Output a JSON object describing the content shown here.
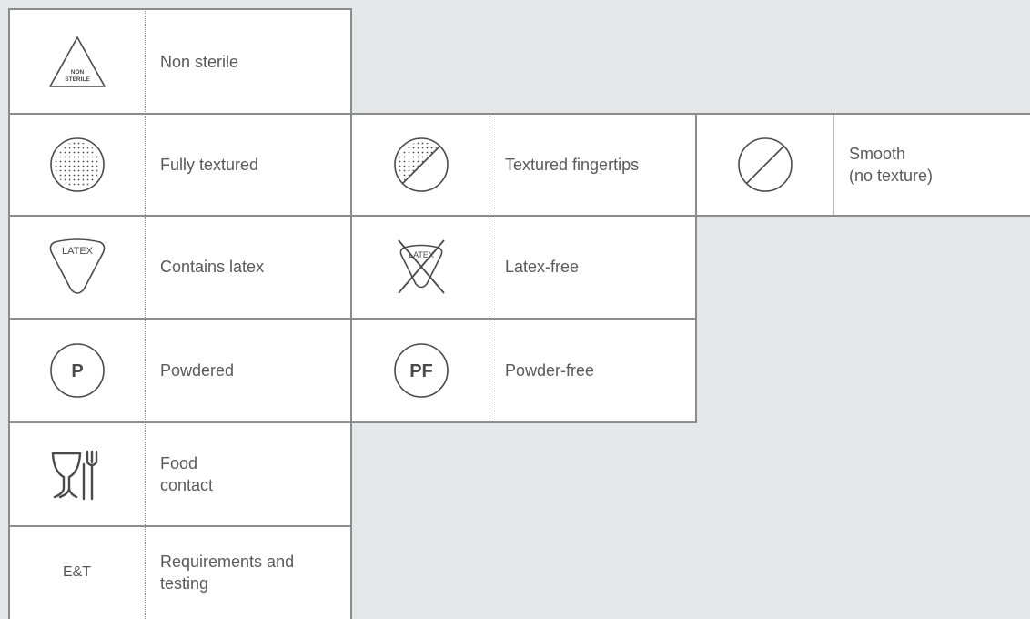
{
  "colors": {
    "background": "#e6e7e9",
    "cell": "#ffffff",
    "border": "#8c8c8c",
    "icon": "#4a4a4a",
    "text": "#5a5a5a"
  },
  "symbols": {
    "non_sterile": {
      "icon": "non-sterile-triangle-icon",
      "icon_text_1": "NON",
      "icon_text_2": "STERILE",
      "label": "Non sterile"
    },
    "fully_textured": {
      "icon": "fully-textured-icon",
      "label": "Fully textured"
    },
    "textured_fingertips": {
      "icon": "textured-fingertips-icon",
      "label": "Textured fingertips"
    },
    "smooth": {
      "icon": "smooth-no-texture-icon",
      "label": "Smooth\n(no texture)"
    },
    "contains_latex": {
      "icon": "latex-icon",
      "icon_text": "LATEX",
      "label": "Contains latex"
    },
    "latex_free": {
      "icon": "latex-free-icon",
      "icon_text": "LATEX",
      "label": "Latex-free"
    },
    "powdered": {
      "icon": "powdered-icon",
      "icon_text": "P",
      "label": "Powdered"
    },
    "powder_free": {
      "icon": "powder-free-icon",
      "icon_text": "PF",
      "label": "Powder-free"
    },
    "food_contact": {
      "icon": "glass-fork-icon",
      "label": "Food\ncontact"
    },
    "requirements": {
      "icon_text": "E&T",
      "label": "Requirements and\ntesting"
    }
  }
}
